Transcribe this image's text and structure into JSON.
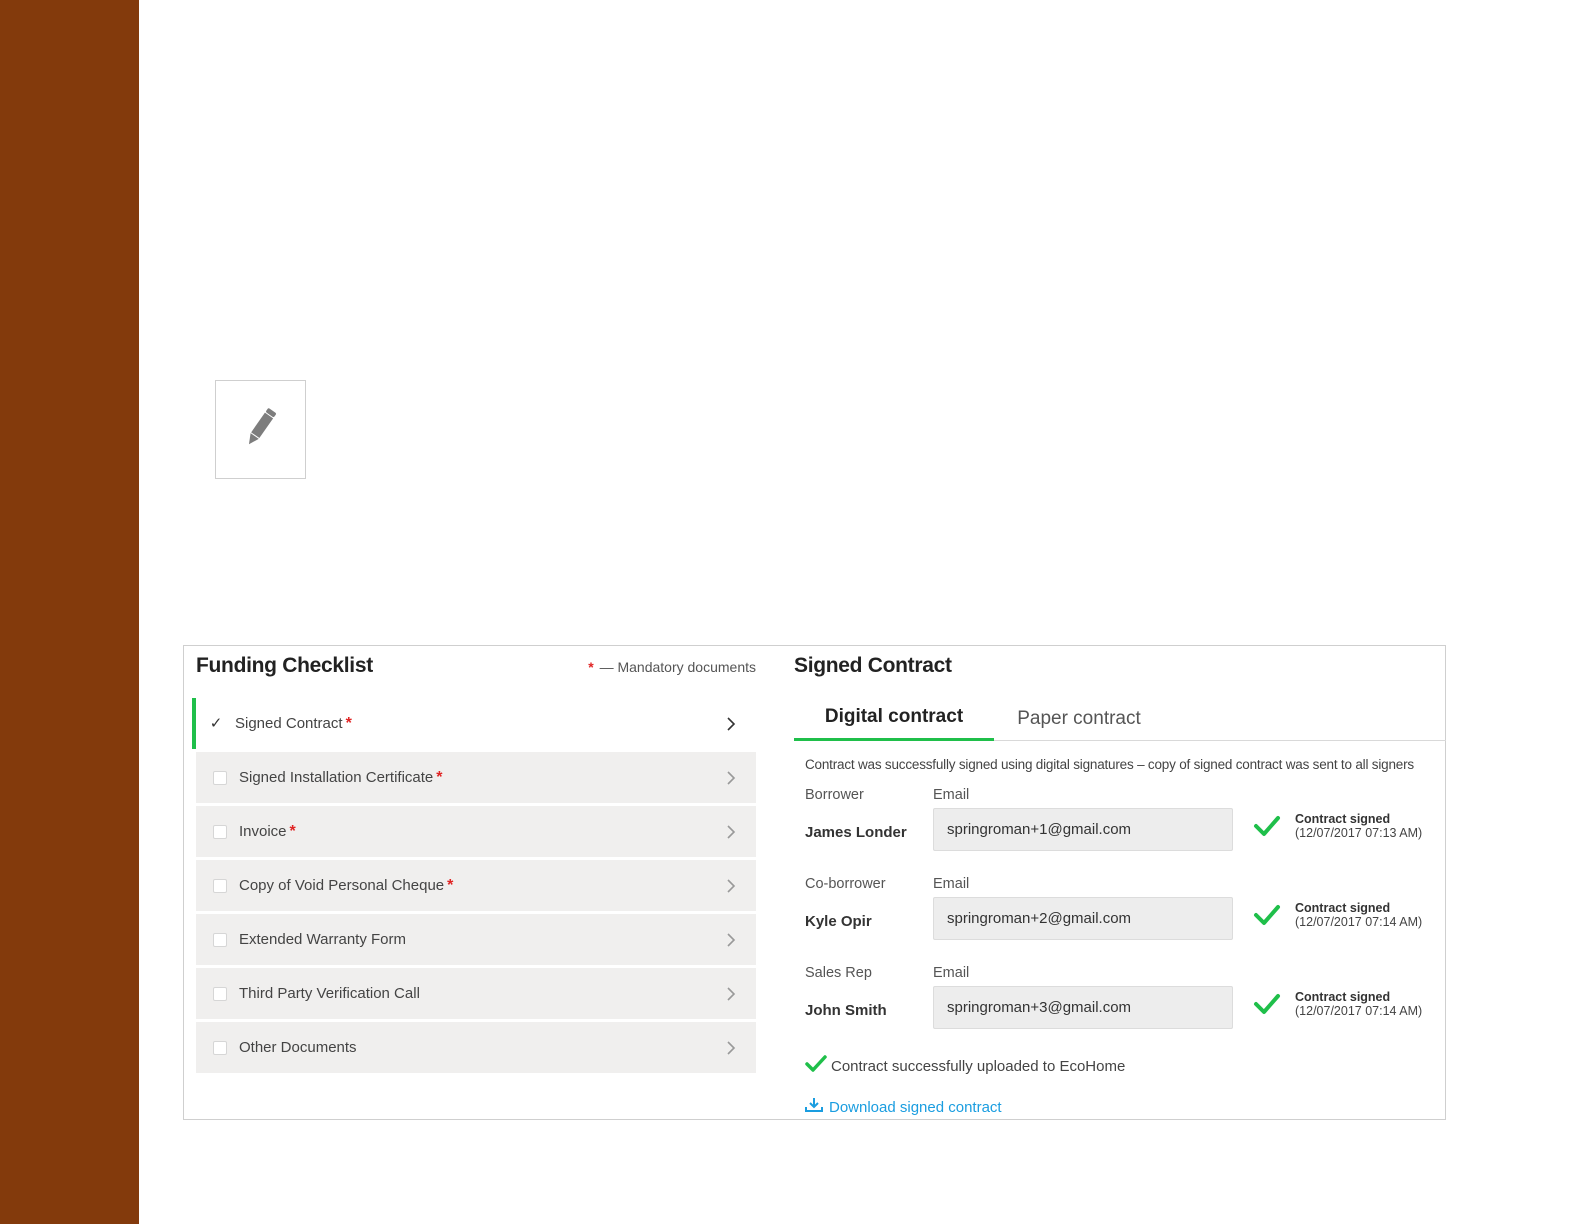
{
  "colors": {
    "sidebar": "#833a0c",
    "accent_green": "#1fbf4a",
    "required_red": "#e02424",
    "link_blue": "#1a9de0"
  },
  "edit_tile": {
    "icon": "pencil-icon"
  },
  "checklist": {
    "title": "Funding Checklist",
    "mandatory_star": "*",
    "mandatory_note": "— Mandatory documents",
    "items": [
      {
        "label": "Signed Contract",
        "required": "*",
        "checked": true,
        "active": true
      },
      {
        "label": "Signed Installation Certificate",
        "required": "*",
        "checked": false
      },
      {
        "label": "Invoice",
        "required": "*",
        "checked": false
      },
      {
        "label": "Copy of Void Personal Cheque",
        "required": "*",
        "checked": false
      },
      {
        "label": "Extended Warranty Form",
        "required": "",
        "checked": false
      },
      {
        "label": "Third Party Verification Call",
        "required": "",
        "checked": false
      },
      {
        "label": "Other Documents",
        "required": "",
        "checked": false
      }
    ]
  },
  "contract": {
    "title": "Signed Contract",
    "tabs": [
      {
        "label": "Digital contract",
        "active": true
      },
      {
        "label": "Paper contract",
        "active": false
      }
    ],
    "success_message": "Contract was successfully signed using digital signatures – copy of signed contract was sent to all signers",
    "signers": [
      {
        "role": "Borrower",
        "email_label": "Email",
        "name": "James Londer",
        "email": "springroman+1@gmail.com",
        "status": "Contract signed",
        "timestamp": "(12/07/2017 07:13 AM)"
      },
      {
        "role": "Co-borrower",
        "email_label": "Email",
        "name": "Kyle Opir",
        "email": "springroman+2@gmail.com",
        "status": "Contract signed",
        "timestamp": "(12/07/2017 07:14 AM)"
      },
      {
        "role": "Sales Rep",
        "email_label": "Email",
        "name": "John Smith",
        "email": "springroman+3@gmail.com",
        "status": "Contract signed",
        "timestamp": "(12/07/2017 07:14 AM)"
      }
    ],
    "upload_message": "Contract successfully uploaded to EcoHome",
    "download_label": "Download signed contract"
  }
}
